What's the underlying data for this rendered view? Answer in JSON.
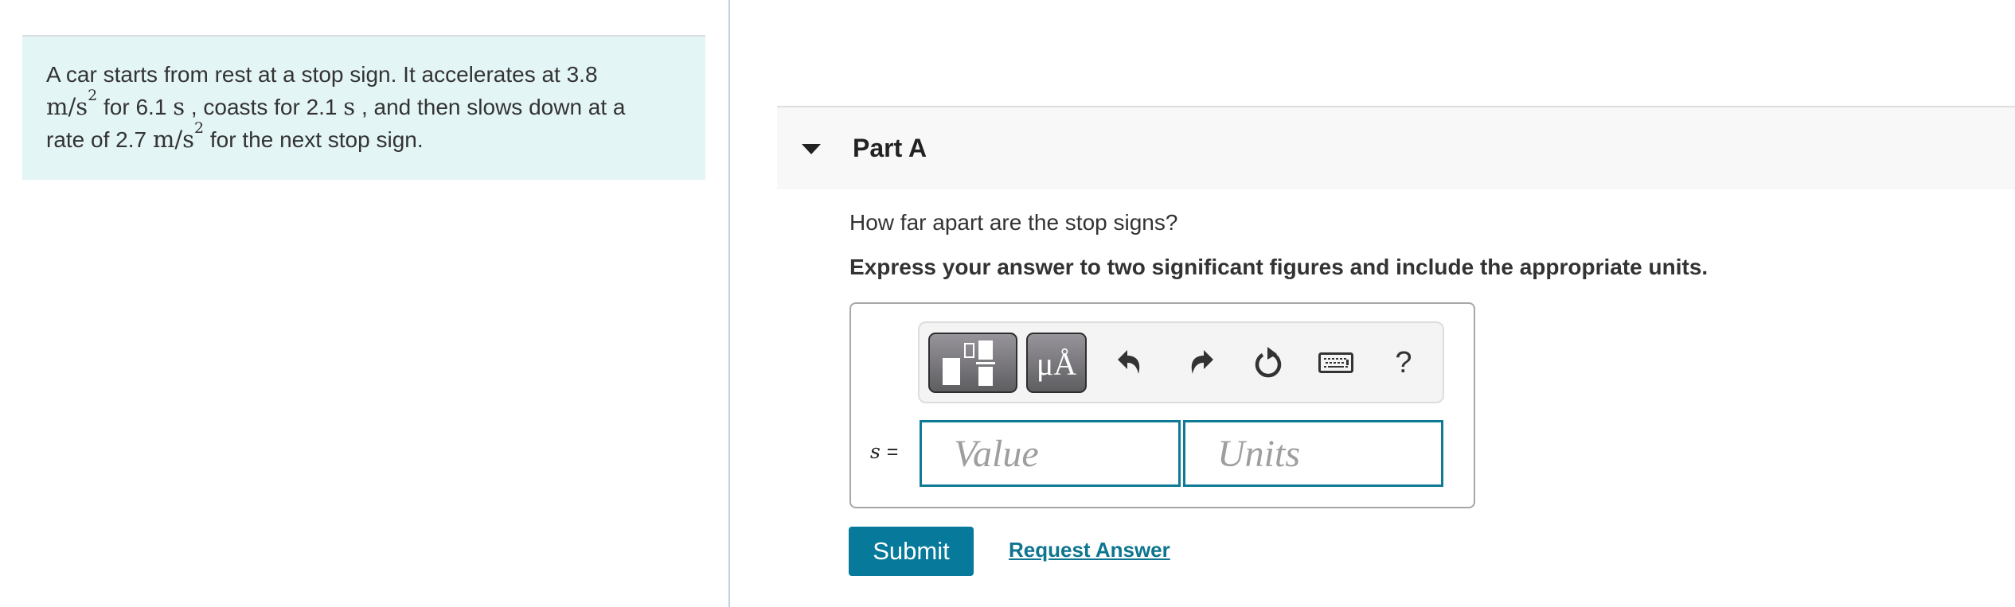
{
  "problem": {
    "segments": [
      {
        "type": "text",
        "value": "A car starts from rest at a stop sign. It accelerates at 3.8 "
      },
      {
        "type": "math",
        "value": "m/s",
        "sup": "2"
      },
      {
        "type": "text",
        "value": " for 6.1 "
      },
      {
        "type": "math",
        "value": "s"
      },
      {
        "type": "text",
        "value": " , coasts for 2.1 "
      },
      {
        "type": "math",
        "value": "s"
      },
      {
        "type": "text",
        "value": " , and then slows down at a rate of 2.7 "
      },
      {
        "type": "math",
        "value": "m/s",
        "sup": "2"
      },
      {
        "type": "text",
        "value": " for the next stop sign."
      }
    ],
    "line1": "A car starts from rest at a stop sign. It accelerates at 3.8",
    "line2_unit": "m/s",
    "line2_unit_exp": "2",
    "line2_a": " for 6.1 ",
    "line2_s1": "s",
    "line2_b": " , coasts for 2.1 ",
    "line2_s2": "s",
    "line2_c": " , and then slows down at a",
    "line3_a": "rate of 2.7 ",
    "line3_unit": "m/s",
    "line3_unit_exp": "2",
    "line3_b": " for the next stop sign."
  },
  "part": {
    "title": "Part A",
    "toggle_icon": "caret-down-icon",
    "question": "How far apart are the stop signs?",
    "instruction": "Express your answer to two significant figures and include the appropriate units."
  },
  "toolbar": {
    "templates_icon": "templates-icon",
    "units_label": "μÅ",
    "undo_icon": "undo-icon",
    "redo_icon": "redo-icon",
    "reset_icon": "reset-icon",
    "keyboard_icon": "keyboard-icon",
    "help_label": "?"
  },
  "answer": {
    "variable": "s",
    "equals": "=",
    "value": "",
    "value_placeholder": "Value",
    "units": "",
    "units_placeholder": "Units"
  },
  "actions": {
    "submit_label": "Submit",
    "request_answer_label": "Request Answer"
  },
  "colors": {
    "problem_bg": "#e4f5f6",
    "accent": "#077a9b",
    "link": "#0d7590",
    "input_border": "#0e7a96"
  }
}
